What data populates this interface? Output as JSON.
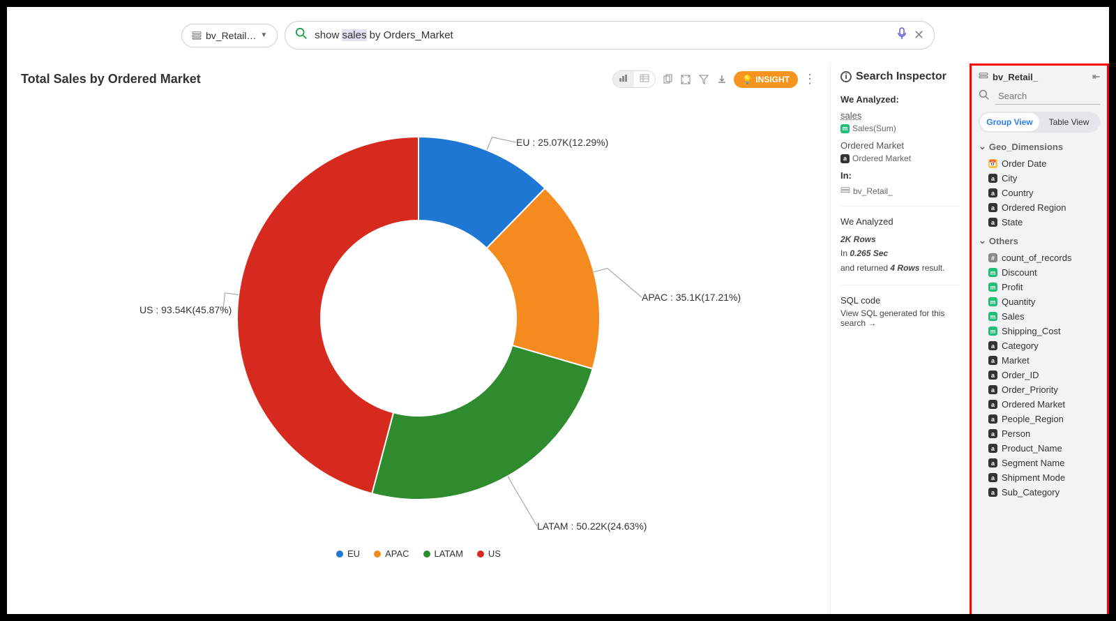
{
  "source_name": "bv_Retail…",
  "search_query_prefix": "show ",
  "search_query_hl": "sales",
  "search_query_suffix": " by Orders_Market",
  "chart": {
    "title": "Total Sales by Ordered Market",
    "toolbar": {
      "insight": "INSIGHT"
    }
  },
  "chart_data": {
    "type": "pie",
    "title": "Total Sales by Ordered Market",
    "series": [
      {
        "name": "EU",
        "value": 25070,
        "percent": 12.29,
        "label": "EU : 25.07K(12.29%)",
        "color": "#1f77d4"
      },
      {
        "name": "APAC",
        "value": 35100,
        "percent": 17.21,
        "label": "APAC : 35.1K(17.21%)",
        "color": "#f58b1f"
      },
      {
        "name": "LATAM",
        "value": 50220,
        "percent": 24.63,
        "label": "LATAM : 50.22K(24.63%)",
        "color": "#2e8b2e"
      },
      {
        "name": "US",
        "value": 93540,
        "percent": 45.87,
        "label": "US : 93.54K(45.87%)",
        "color": "#d62a1f"
      }
    ]
  },
  "inspector": {
    "title": "Search Inspector",
    "we_analyzed": "We Analyzed:",
    "sales": "sales",
    "sales_sub": "Sales(Sum)",
    "ordered_market": "Ordered Market",
    "ordered_market_sub": "Ordered Market",
    "in_label": "In:",
    "in_value": "bv_Retail_",
    "analyzed2": "We Analyzed",
    "rows": "2K Rows",
    "time_prefix": "In ",
    "time_val": "0.265 Sec",
    "returned_prefix": "and returned ",
    "returned_val": "4 Rows",
    "returned_suffix": " result.",
    "sql_label": "SQL code",
    "sql_link": "View SQL generated for this search →"
  },
  "panel": {
    "source": "bv_Retail_",
    "search_placeholder": "Search",
    "group_view": "Group View",
    "table_view": "Table View",
    "groups": [
      {
        "name": "Geo_Dimensions",
        "fields": [
          {
            "name": "Order Date",
            "type": "date"
          },
          {
            "name": "City",
            "type": "dim"
          },
          {
            "name": "Country",
            "type": "dim"
          },
          {
            "name": "Ordered Region",
            "type": "dim"
          },
          {
            "name": "State",
            "type": "dim"
          }
        ]
      },
      {
        "name": "Others",
        "fields": [
          {
            "name": "count_of_records",
            "type": "num"
          },
          {
            "name": "Discount",
            "type": "measure"
          },
          {
            "name": "Profit",
            "type": "measure"
          },
          {
            "name": "Quantity",
            "type": "measure"
          },
          {
            "name": "Sales",
            "type": "measure"
          },
          {
            "name": "Shipping_Cost",
            "type": "measure"
          },
          {
            "name": "Category",
            "type": "dim"
          },
          {
            "name": "Market",
            "type": "dim"
          },
          {
            "name": "Order_ID",
            "type": "dim"
          },
          {
            "name": "Order_Priority",
            "type": "dim"
          },
          {
            "name": "Ordered Market",
            "type": "dim"
          },
          {
            "name": "People_Region",
            "type": "dim"
          },
          {
            "name": "Person",
            "type": "dim"
          },
          {
            "name": "Product_Name",
            "type": "dim"
          },
          {
            "name": "Segment Name",
            "type": "dim"
          },
          {
            "name": "Shipment Mode",
            "type": "dim"
          },
          {
            "name": "Sub_Category",
            "type": "dim"
          }
        ]
      }
    ]
  }
}
